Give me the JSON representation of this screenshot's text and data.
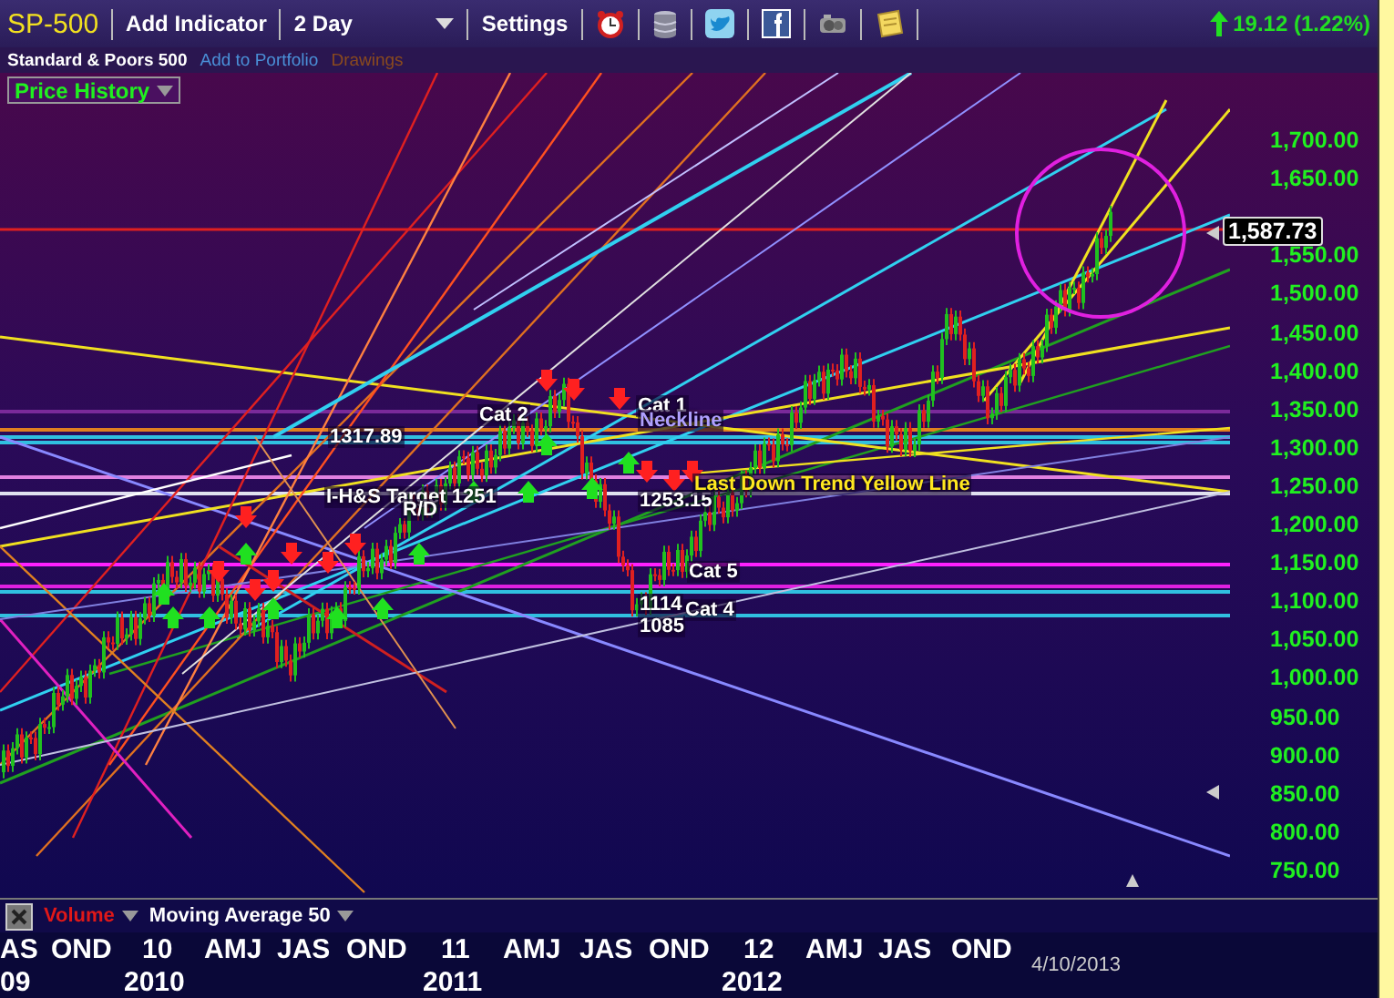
{
  "toolbar": {
    "symbol": "SP-500",
    "items": [
      {
        "kind": "menu",
        "label": "Add Indicator"
      },
      {
        "kind": "dropdown",
        "label": "2 Day"
      },
      {
        "kind": "menu",
        "label": "Settings"
      }
    ],
    "change": "19.12 (1.22%)"
  },
  "subbar": {
    "name": "Standard & Poors 500",
    "links": [
      {
        "label": "Add to Portfolio",
        "color": "#4a90d8"
      },
      {
        "label": "Drawings",
        "color": "#8a4a1e"
      }
    ]
  },
  "chart": {
    "view": "Price History",
    "last_price": "1,587.73",
    "y_axis": [
      "1,700.00",
      "1,650.00",
      "1,550.00",
      "1,500.00",
      "1,450.00",
      "1,400.00",
      "1,350.00",
      "1,300.00",
      "1,250.00",
      "1,200.00",
      "1,150.00",
      "1,100.00",
      "1,050.00",
      "1,000.00",
      "950.00",
      "900.00",
      "850.00",
      "800.00",
      "750.00"
    ],
    "annotations": [
      {
        "text": "1317.89",
        "kind": "white"
      },
      {
        "text": "I-H&S Target 1251",
        "kind": "white"
      },
      {
        "text": "R/D",
        "kind": "white"
      },
      {
        "text": "Cat 2",
        "kind": "white"
      },
      {
        "text": "Cat 1",
        "kind": "white"
      },
      {
        "text": "Neckline",
        "kind": "lavender"
      },
      {
        "text": "1253.15",
        "kind": "white"
      },
      {
        "text": "Last Down Trend Yellow Line",
        "kind": "yellow"
      },
      {
        "text": "Cat 5",
        "kind": "white"
      },
      {
        "text": "1114",
        "kind": "white"
      },
      {
        "text": "1085",
        "kind": "white"
      },
      {
        "text": "Cat 4",
        "kind": "white"
      }
    ]
  },
  "indicators": [
    {
      "label": "Volume",
      "color": "#e01818"
    },
    {
      "label": "Moving Average 50",
      "color": "#ffffff"
    }
  ],
  "x_axis": {
    "months": [
      "AS",
      "OND",
      "10",
      "AMJ",
      "JAS",
      "OND",
      "11",
      "AMJ",
      "JAS",
      "OND",
      "12",
      "AMJ",
      "JAS",
      "OND"
    ],
    "years": [
      "09",
      "2010",
      "2011",
      "2012"
    ],
    "date": "4/10/2013"
  }
}
